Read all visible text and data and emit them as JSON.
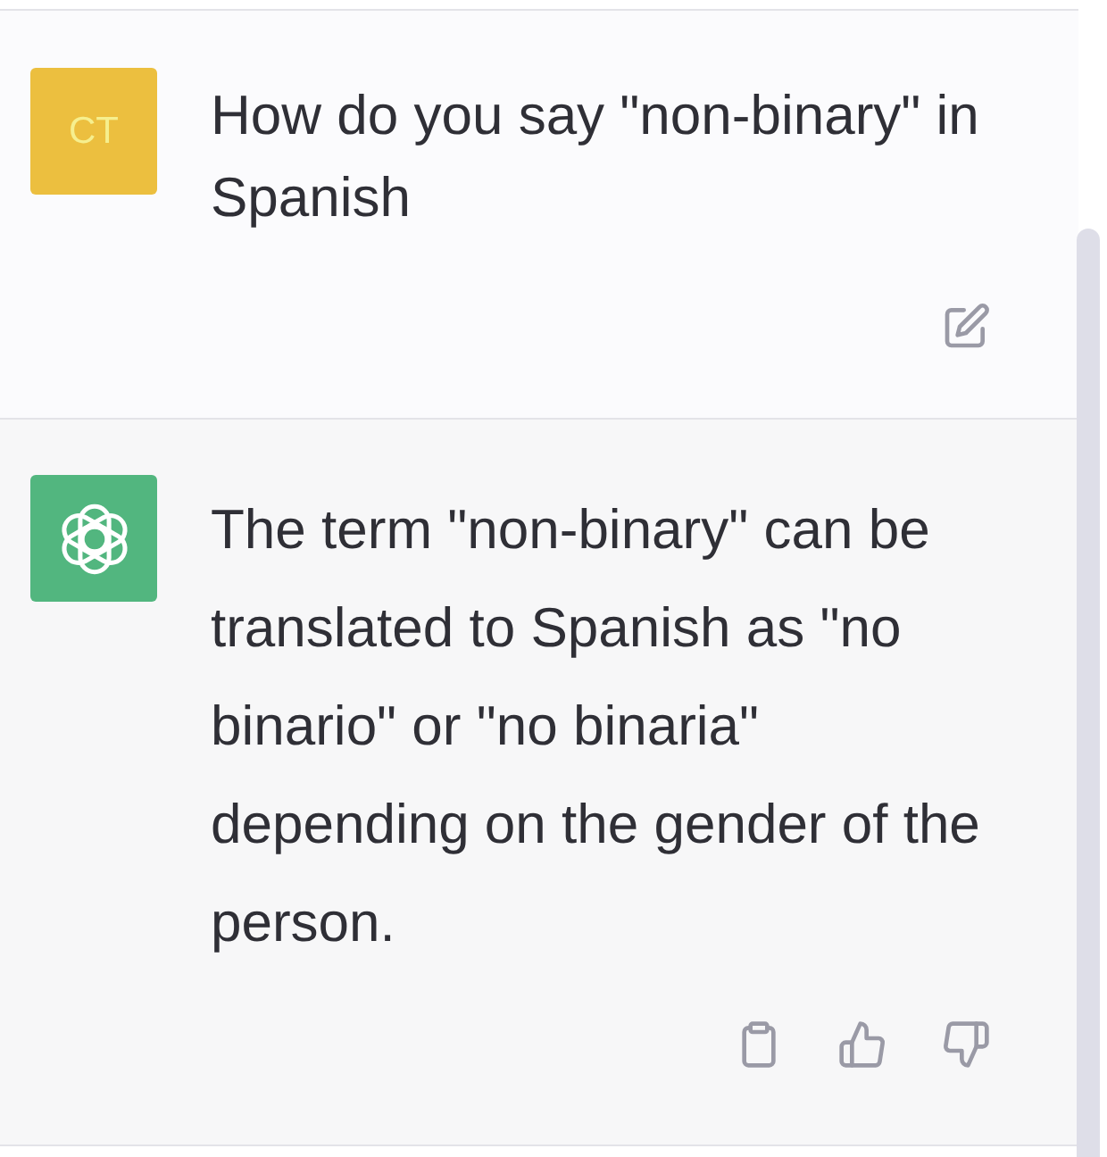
{
  "messages": [
    {
      "kind": "user",
      "avatar": {
        "initials": "CT",
        "color": "#ecbf3f"
      },
      "text": "How do you say \"non-binary\" in Spanish",
      "actions": [
        {
          "kind": "edit"
        }
      ]
    },
    {
      "kind": "assistant",
      "avatar": {
        "color": "#52b67f"
      },
      "text": "The term \"non-binary\" can be translated to Spanish as \"no binario\" or \"no binaria\" depending on the gender of the person.",
      "actions": [
        {
          "kind": "copy"
        },
        {
          "kind": "thumbs_up"
        },
        {
          "kind": "thumbs_down"
        }
      ]
    }
  ]
}
